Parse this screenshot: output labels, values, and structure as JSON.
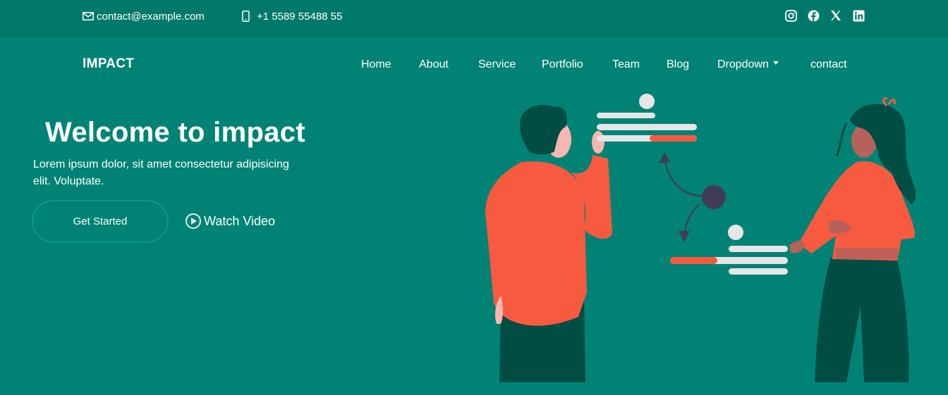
{
  "topbar": {
    "email": "contact@example.com",
    "phone": "+1 5589 55488 55",
    "socials": [
      "instagram-icon",
      "facebook-icon",
      "x-icon",
      "linkedin-icon"
    ]
  },
  "header": {
    "brand": "IMPACT",
    "nav": {
      "home": "Home",
      "about": "About",
      "service": "Service",
      "portfolio": "Portfolio",
      "team": "Team",
      "blog": "Blog",
      "dropdown": "Dropdown",
      "contact": "contact"
    }
  },
  "hero": {
    "title": "Welcome to impact",
    "text": "Lorem ipsum dolor, sit amet consectetur adipisicing elit. Voluptate.",
    "cta": "Get Started",
    "video": "Watch Video"
  },
  "colors": {
    "background": "#008374",
    "topbar": "#00796b",
    "accent": "#f85a40",
    "dark_green": "#004d43"
  }
}
